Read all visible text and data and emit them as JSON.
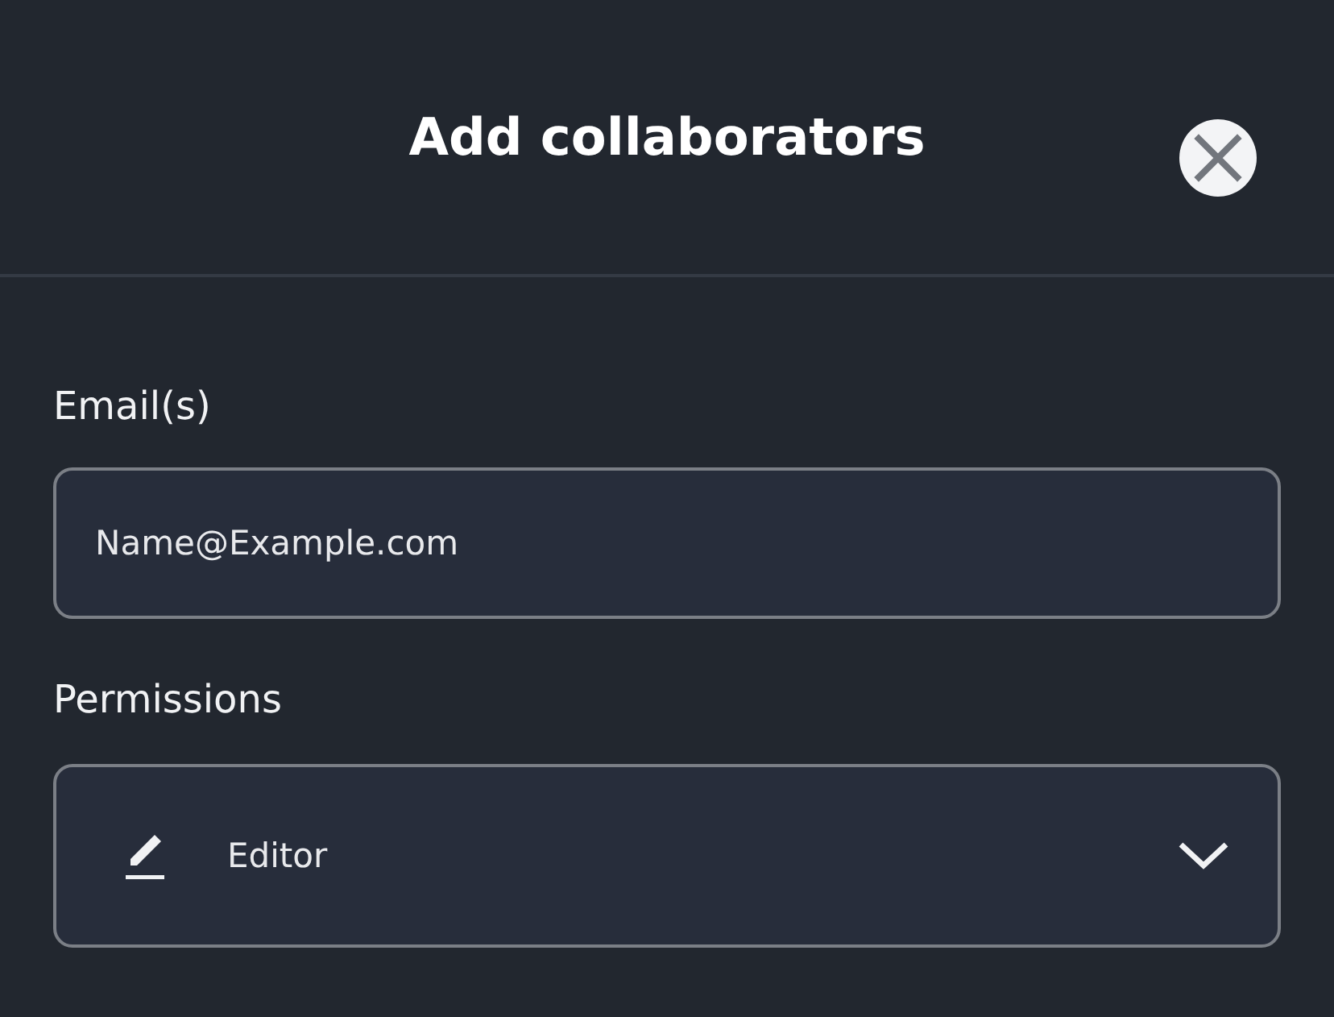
{
  "dialog": {
    "title": "Add collaborators"
  },
  "email": {
    "label": "Email(s)",
    "placeholder": "Name@Example.com"
  },
  "permissions": {
    "label": "Permissions",
    "value": "Editor",
    "expanded": false
  }
}
